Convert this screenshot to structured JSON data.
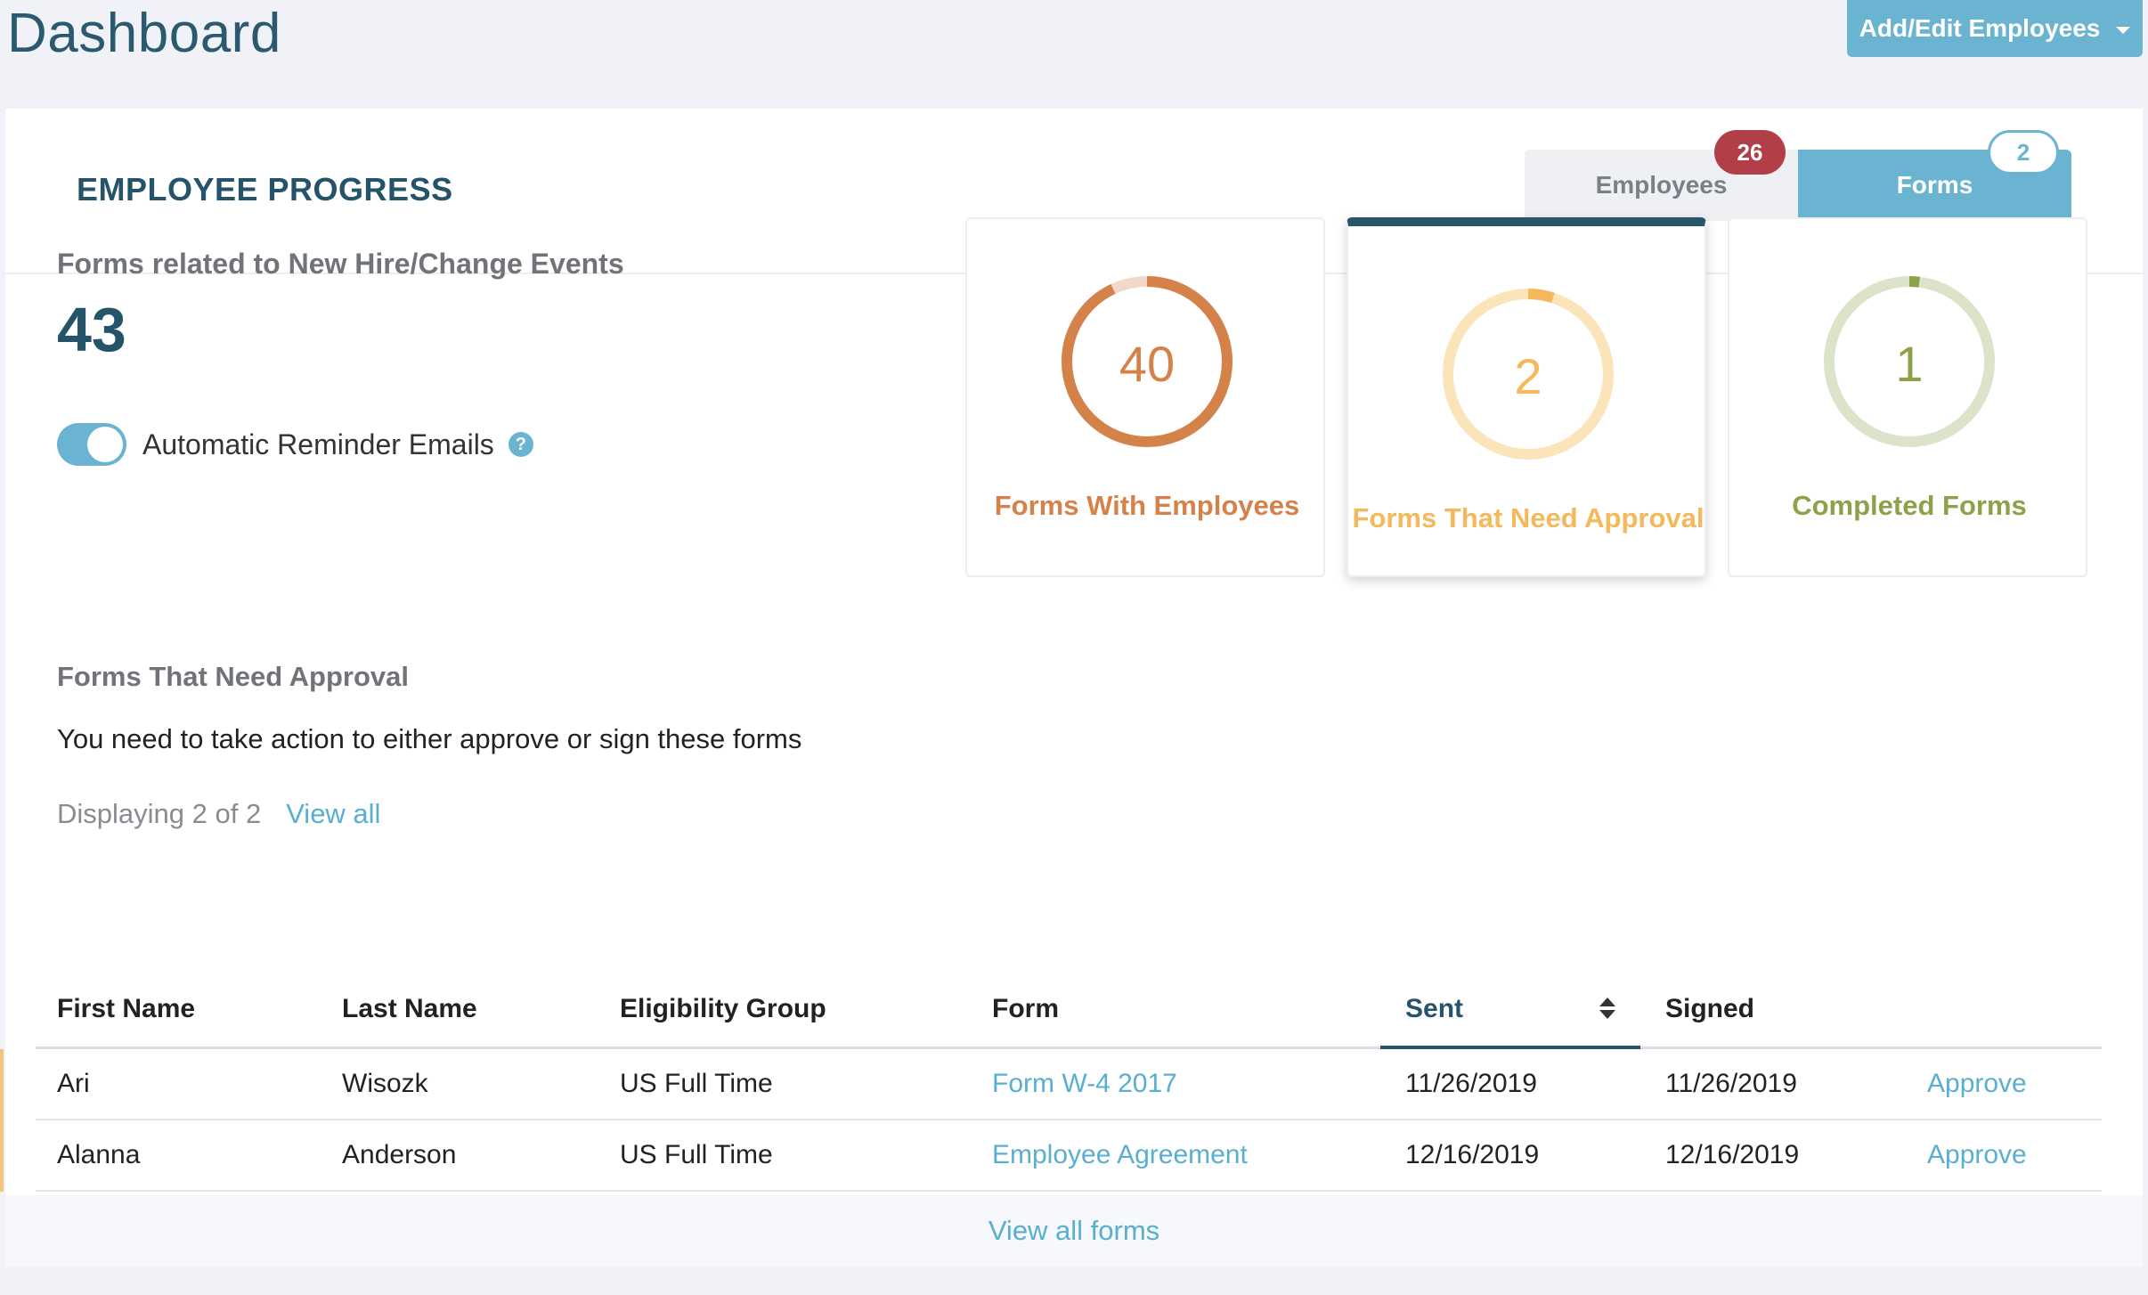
{
  "header": {
    "title": "Dashboard",
    "add_edit_label": "Add/Edit Employees"
  },
  "progress": {
    "section_title": "EMPLOYEE PROGRESS",
    "tabs": [
      {
        "label": "Employees",
        "badge": "26"
      },
      {
        "label": "Forms",
        "badge": "2"
      }
    ],
    "active_tab": "Forms"
  },
  "summary": {
    "label": "Forms related to New Hire/Change Events",
    "count": "43",
    "reminder_label": "Automatic Reminder Emails",
    "reminder_enabled": true,
    "help_glyph": "?"
  },
  "cards": [
    {
      "value": "40",
      "label": "Forms With Employees",
      "fraction": 0.93,
      "color": "#d5814a",
      "track": "#f0d9c8"
    },
    {
      "value": "2",
      "label": "Forms That Need Approval",
      "fraction": 0.05,
      "color": "#f3b95a",
      "track": "#fbe4ba"
    },
    {
      "value": "1",
      "label": "Completed Forms",
      "fraction": 0.02,
      "color": "#8ba24a",
      "track": "#dbe3c8"
    }
  ],
  "active_card_index": 1,
  "approval": {
    "title": "Forms That Need Approval",
    "description": "You need to take action to either approve or sign these forms",
    "display_count": "Displaying 2 of 2",
    "view_all": "View all"
  },
  "table": {
    "columns": [
      "First Name",
      "Last Name",
      "Eligibility Group",
      "Form",
      "Sent",
      "Signed"
    ],
    "rows": [
      {
        "first": "Ari",
        "last": "Wisozk",
        "group": "US Full Time",
        "form": "Form W-4 2017",
        "sent": "11/26/2019",
        "signed": "11/26/2019",
        "action": "Approve"
      },
      {
        "first": "Alanna",
        "last": "Anderson",
        "group": "US Full Time",
        "form": "Employee Agreement",
        "sent": "12/16/2019",
        "signed": "12/16/2019",
        "action": "Approve"
      }
    ],
    "footer_link": "View all forms"
  },
  "colors": {
    "accent": "#6ab4d1",
    "navy": "#24536a",
    "badge_red": "#b23f48"
  }
}
